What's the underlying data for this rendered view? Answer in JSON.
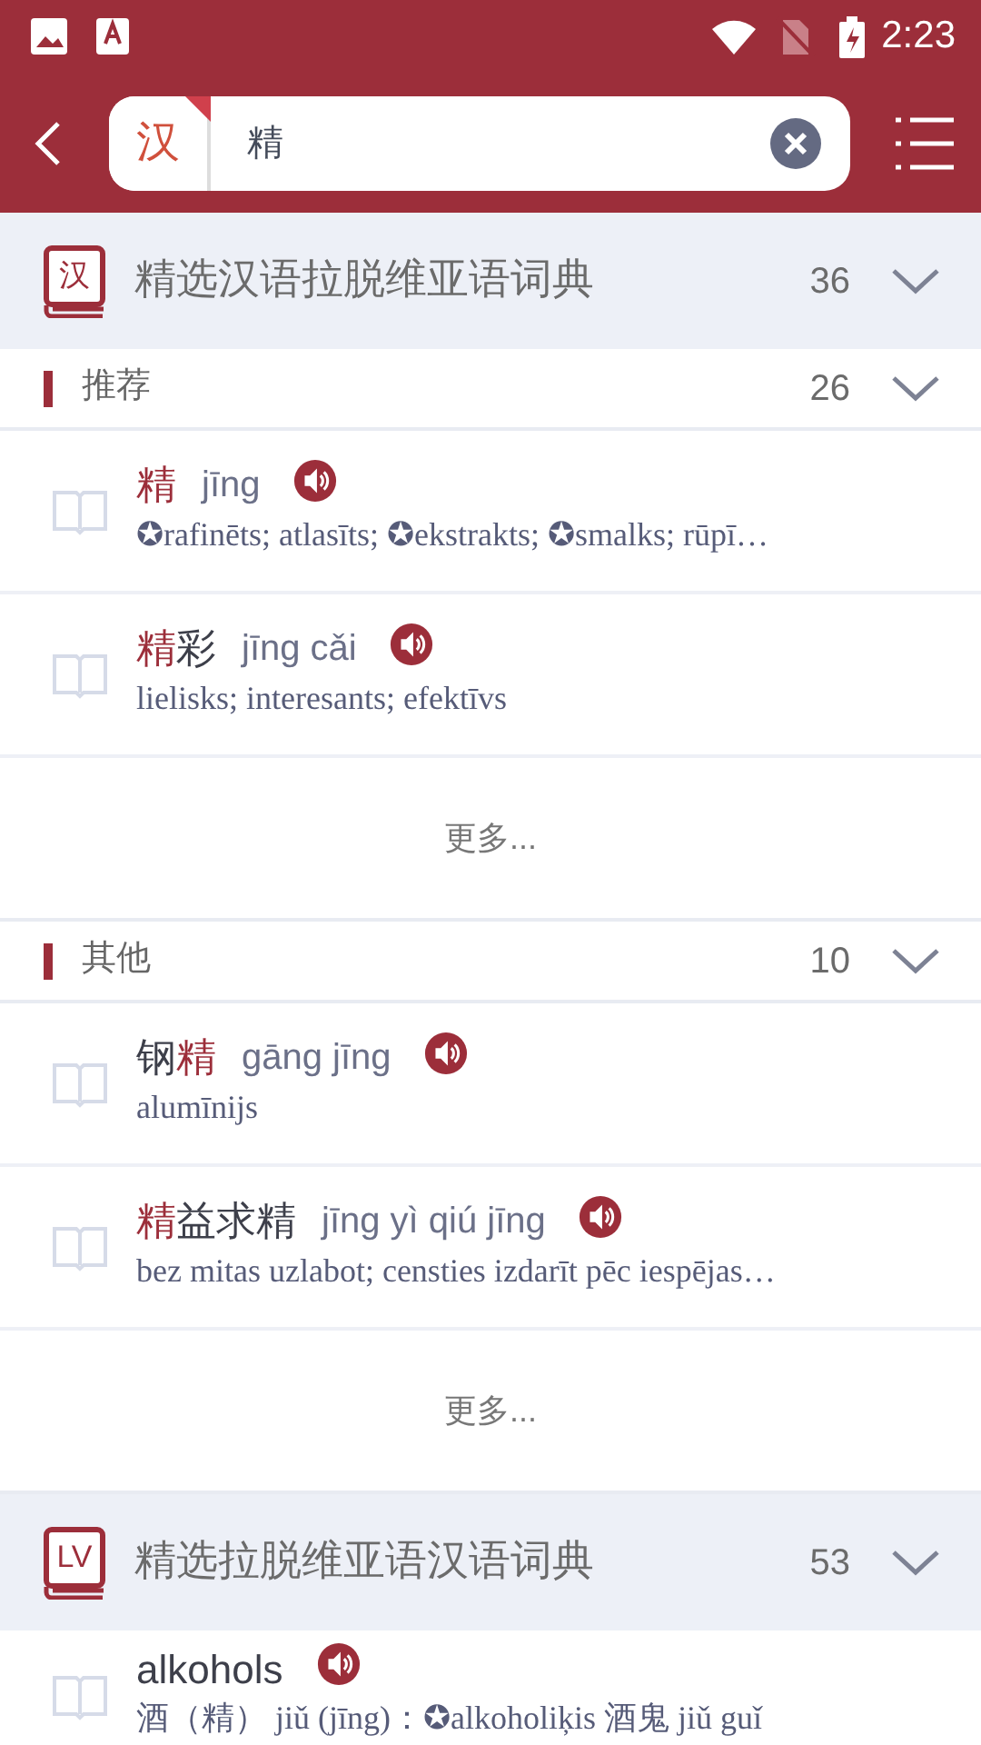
{
  "status_bar": {
    "time": "2:23"
  },
  "search": {
    "language": "汉",
    "value": "精"
  },
  "dictionaries": [
    {
      "icon_label": "汉",
      "title": "精选汉语拉脱维亚语词典",
      "count": "36",
      "groups": [
        {
          "label": "推荐",
          "count": "26",
          "more": "更多...",
          "entries": [
            {
              "headword": [
                {
                  "text": "精",
                  "match": true
                }
              ],
              "pinyin": "jīng",
              "definition": "✪rafinēts; atlasīts; ✪ekstrakts; ✪smalks; rūpī…"
            },
            {
              "headword": [
                {
                  "text": "精",
                  "match": true
                },
                {
                  "text": "彩",
                  "match": false
                }
              ],
              "pinyin": "jīng cǎi",
              "definition": "lielisks; interesants; efektīvs"
            }
          ]
        },
        {
          "label": "其他",
          "count": "10",
          "more": "更多...",
          "entries": [
            {
              "headword": [
                {
                  "text": "钢",
                  "match": false
                },
                {
                  "text": "精",
                  "match": true
                }
              ],
              "pinyin": "gāng jīng",
              "definition": "alumīnijs"
            },
            {
              "headword": [
                {
                  "text": "精",
                  "match": true
                },
                {
                  "text": "益求精",
                  "match": false
                }
              ],
              "pinyin": "jīng yì qiú jīng",
              "definition": "bez mitas uzlabot; censties izdarīt pēc iespējas…"
            }
          ]
        }
      ]
    },
    {
      "icon_label": "LV",
      "title": "精选拉脱维亚语汉语词典",
      "count": "53",
      "groups": [
        {
          "entries": [
            {
              "headword": [
                {
                  "text": "alkohols",
                  "match": false
                }
              ],
              "definition": "酒（精） jiǔ (jīng)：✪alkoholiķis 酒鬼 jiǔ guǐ"
            }
          ]
        }
      ]
    }
  ]
}
